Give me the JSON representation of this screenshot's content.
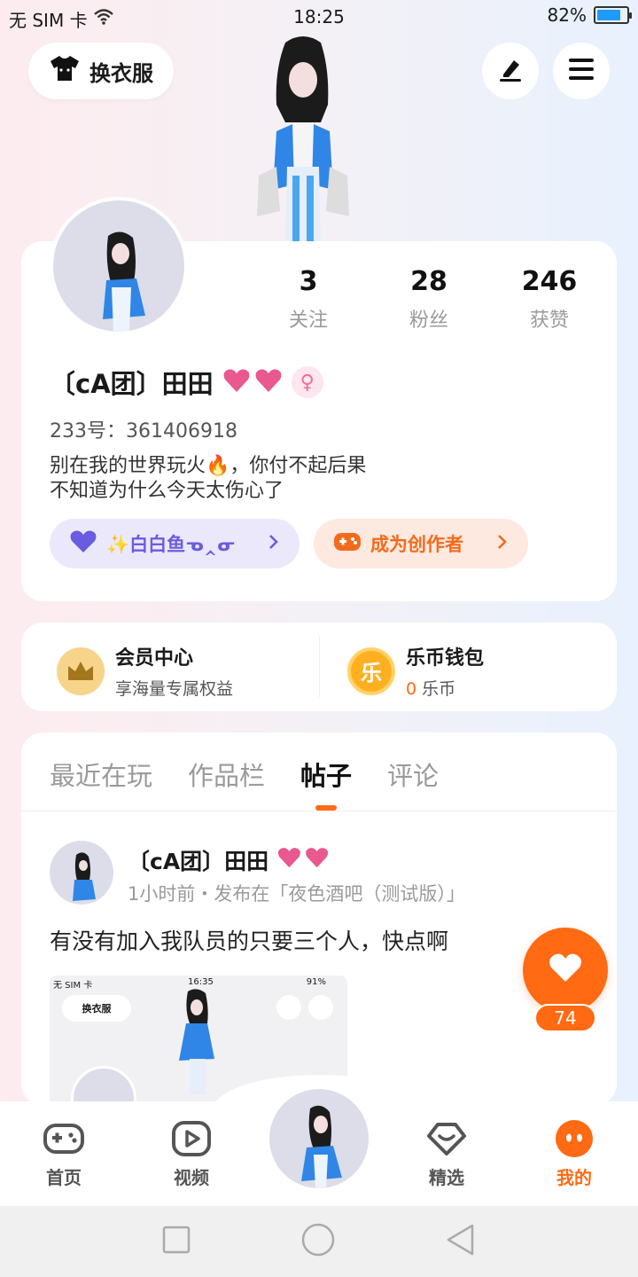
{
  "status_bar": {
    "carrier": "无 SIM 卡",
    "time": "18:25",
    "battery": "82%",
    "battery_level": 0.82
  },
  "header": {
    "outfit_label": "换衣服"
  },
  "profile": {
    "stats": [
      {
        "value": "3",
        "label": "关注"
      },
      {
        "value": "28",
        "label": "粉丝"
      },
      {
        "value": "246",
        "label": "获赞"
      }
    ],
    "name": "〔cA团〕田田",
    "uid": "233号：361406918",
    "bio_line1": "别在我的世界玩火🔥，你付不起后果",
    "bio_line2": "不知道为什么今天太伤心了",
    "fan_club_label": "✨白白鱼ᓀ‸ᓂ",
    "creator_label": "成为创作者"
  },
  "wallet": {
    "member_title": "会员中心",
    "member_sub": "享海量专属权益",
    "coin_title": "乐币钱包",
    "coin_icon_text": "乐",
    "coin_amount": "0",
    "coin_unit": "乐币"
  },
  "feed": {
    "tabs": [
      "最近在玩",
      "作品栏",
      "帖子",
      "评论"
    ],
    "active_tab": "帖子",
    "post": {
      "author": "〔cA团〕田田",
      "meta": "1小时前・发布在「夜色酒吧（测试版）」",
      "text": "有没有加入我队员的只要三个人，快点啊",
      "thumb_carrier": "无 SIM 卡",
      "thumb_time": "16:35",
      "thumb_battery": "91%",
      "thumb_outfit": "换衣服"
    }
  },
  "like": {
    "count": "74"
  },
  "bottom_nav": {
    "home": "首页",
    "video": "视频",
    "featured": "精选",
    "mine": "我的"
  },
  "colors": {
    "accent": "#ff6a13",
    "purple": "#6a5ce0",
    "heart_pink": "#e9588e"
  }
}
